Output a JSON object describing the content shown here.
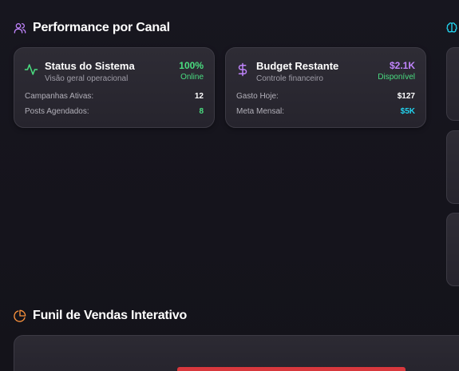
{
  "performance": {
    "title": "Performance por Canal",
    "cards": [
      {
        "title": "Status do Sistema",
        "subtitle": "Visão geral operacional",
        "value": "100%",
        "status": "Online",
        "icon": "activity-icon",
        "rows": [
          {
            "label": "Campanhas Ativas:",
            "value": "12"
          },
          {
            "label": "Posts Agendados:",
            "value": "8"
          }
        ]
      },
      {
        "title": "Budget Restante",
        "subtitle": "Controle financeiro",
        "value": "$2.1K",
        "status": "Disponível",
        "icon": "dollar-icon",
        "rows": [
          {
            "label": "Gasto Hoje:",
            "value": "$127"
          },
          {
            "label": "Meta Mensal:",
            "value": "$5K"
          }
        ]
      }
    ]
  },
  "funnel": {
    "title": "Funil de Vendas Interativo"
  },
  "colors": {
    "green": "#4ade80",
    "purple": "#c084fc",
    "cyan": "#22d3ee",
    "orange": "#fb923c",
    "red": "#d8383d"
  }
}
